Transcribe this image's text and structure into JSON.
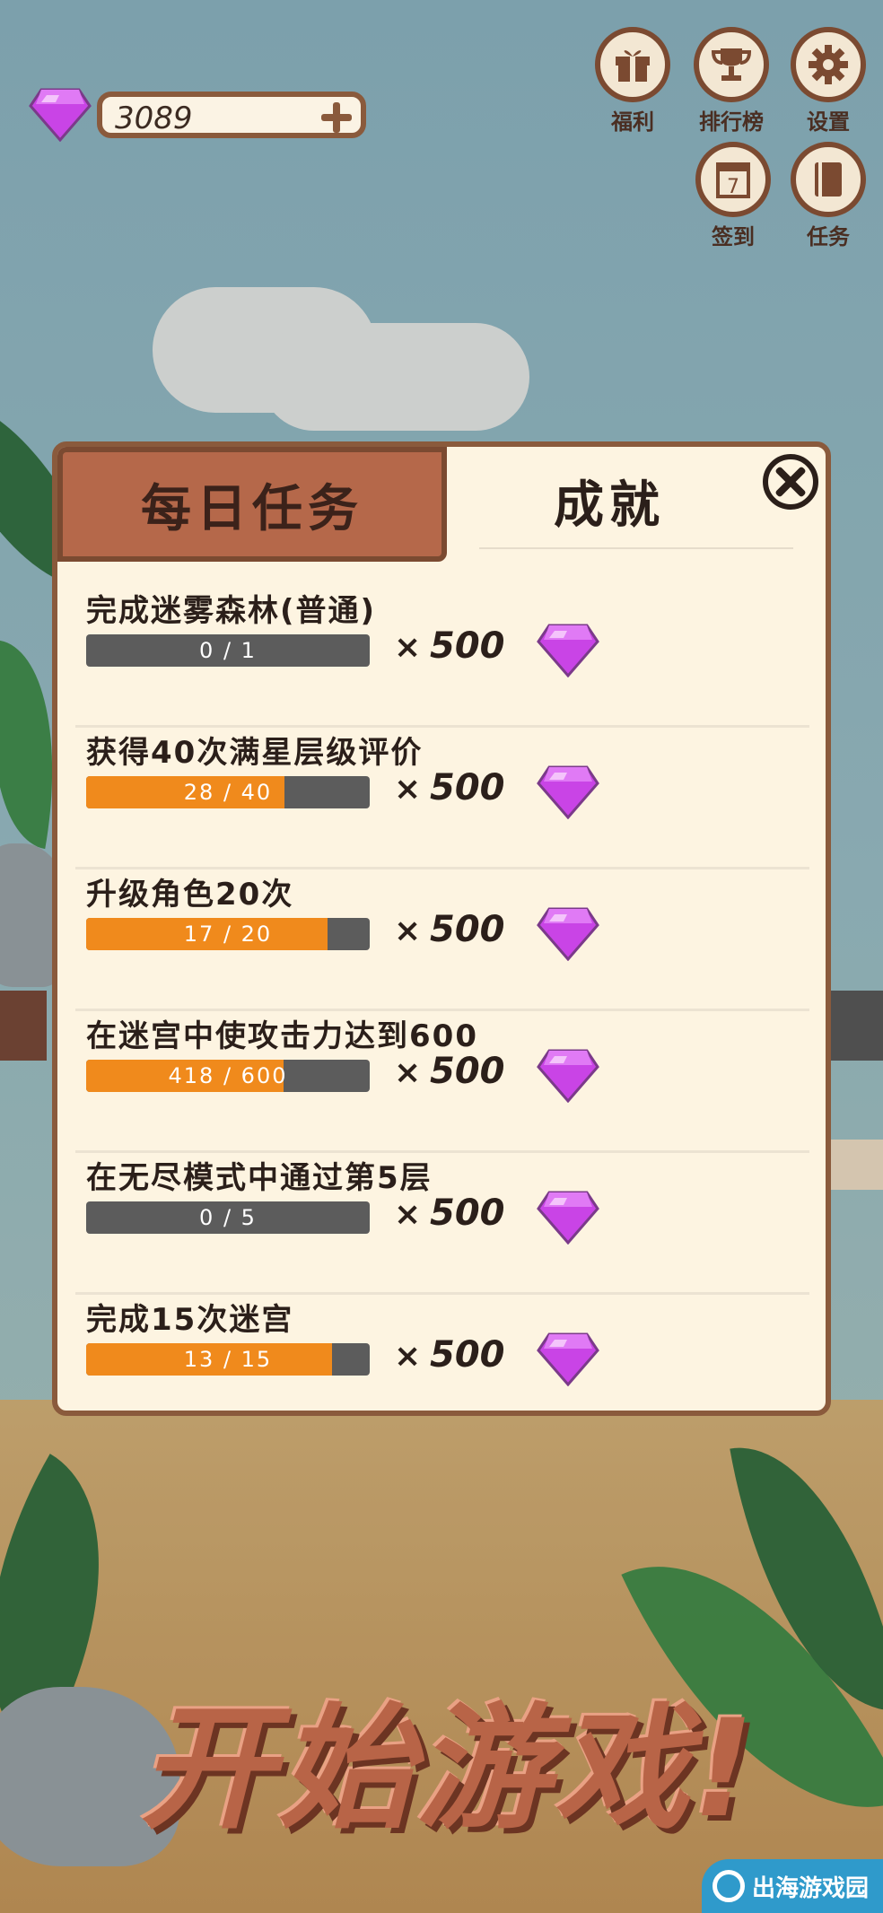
{
  "header": {
    "gems": "3089",
    "gem_icon": "purple-gem-icon",
    "add_icon": "plus-icon"
  },
  "menu": [
    {
      "label": "福利",
      "icon": "gift-icon"
    },
    {
      "label": "排行榜",
      "icon": "trophy-icon"
    },
    {
      "label": "设置",
      "icon": "gear-icon"
    },
    {
      "label": "签到",
      "icon": "calendar-icon"
    },
    {
      "label": "任务",
      "icon": "book-icon"
    }
  ],
  "calendar_day": "7",
  "panel": {
    "tabs": [
      {
        "label": "每日任务",
        "active": true
      },
      {
        "label": "成就",
        "active": false
      }
    ],
    "close_icon": "close-icon",
    "tasks": [
      {
        "title": "完成迷雾森林(普通)",
        "progress": "0 / 1",
        "fraction": 0.0,
        "reward_x": "×",
        "reward": "500"
      },
      {
        "title": "获得40次满星层级评价",
        "progress": "28 / 40",
        "fraction": 0.7,
        "reward_x": "×",
        "reward": "500"
      },
      {
        "title": "升级角色20次",
        "progress": "17 / 20",
        "fraction": 0.85,
        "reward_x": "×",
        "reward": "500"
      },
      {
        "title": "在迷宫中使攻击力达到600",
        "progress": "418 / 600",
        "fraction": 0.6967,
        "reward_x": "×",
        "reward": "500"
      },
      {
        "title": "在无尽模式中通过第5层",
        "progress": "0 / 5",
        "fraction": 0.0,
        "reward_x": "×",
        "reward": "500"
      },
      {
        "title": "完成15次迷宫",
        "progress": "13 / 15",
        "fraction": 0.8667,
        "reward_x": "×",
        "reward": "500"
      }
    ]
  },
  "start_button": "开始游戏!",
  "watermark": "出海游戏园",
  "colors": {
    "panel_bg": "#fdf4e1",
    "border": "#8a5a3c",
    "tab_active": "#b5684a",
    "progress_fill": "#f08a1c",
    "progress_track": "#5c5c5c",
    "gem": "#c944e6"
  }
}
